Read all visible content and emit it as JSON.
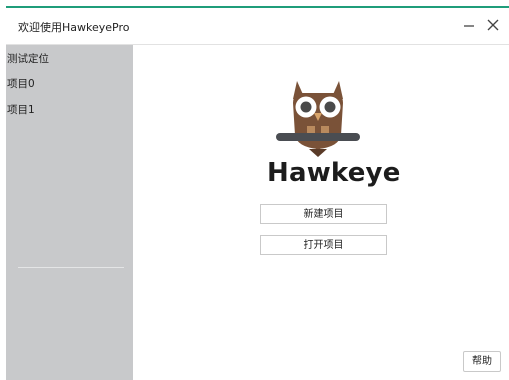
{
  "window": {
    "title": "欢迎使用HawkeyePro",
    "accent_color": "#1f9d7a",
    "controls": {
      "minimize_icon": "minimize-icon",
      "close_icon": "close-icon"
    }
  },
  "sidebar": {
    "background": "#c8c9cb",
    "items": [
      {
        "label": "测试定位"
      },
      {
        "label": "项目0"
      },
      {
        "label": "项目1"
      }
    ]
  },
  "main": {
    "logo_icon": "owl-logo-icon",
    "brand": "Hawkeye",
    "new_project_label": "新建项目",
    "open_project_label": "打开项目",
    "help_label": "帮助"
  }
}
